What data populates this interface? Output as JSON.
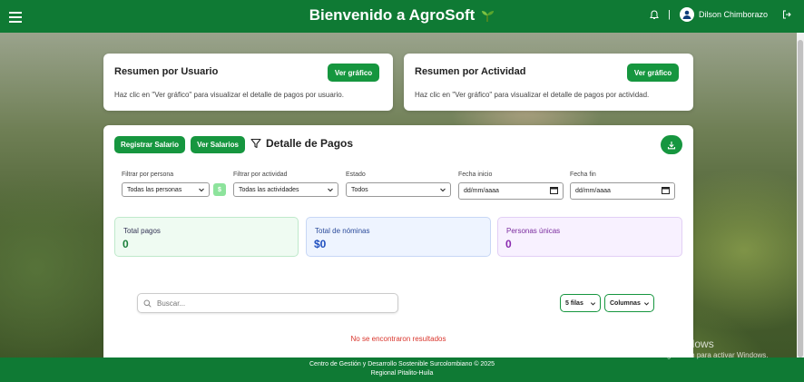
{
  "header": {
    "title": "Bienvenido a AgroSoft",
    "user_name": "Dilson Chimborazo",
    "separator": "|",
    "brand_color": "#0f7a34"
  },
  "summary_cards": [
    {
      "title": "Resumen por Usuario",
      "button": "Ver gráfico",
      "description": "Haz clic en \"Ver gráfico\" para visualizar el detalle de pagos por usuario."
    },
    {
      "title": "Resumen por Actividad",
      "button": "Ver gráfico",
      "description": "Haz clic en \"Ver gráfico\" para visualizar el detalle de pagos por actividad."
    }
  ],
  "main": {
    "register_salary": "Registrar Salario",
    "view_salaries": "Ver Salarios",
    "title": "Detalle de Pagos"
  },
  "filters": {
    "person": {
      "label": "Filtrar por persona",
      "value": "Todas las personas",
      "button": "$"
    },
    "activity": {
      "label": "Filtrar por actividad",
      "value": "Todas las actividades"
    },
    "status": {
      "label": "Estado",
      "value": "Todos"
    },
    "date_start": {
      "label": "Fecha inicio",
      "value": "dd/mm/aaaa"
    },
    "date_end": {
      "label": "Fecha fin",
      "value": "dd/mm/aaaa"
    }
  },
  "stats": [
    {
      "label": "Total pagos",
      "value": "0"
    },
    {
      "label": "Total de nóminas",
      "value": "$0"
    },
    {
      "label": "Personas únicas",
      "value": "0"
    }
  ],
  "table": {
    "search_placeholder": "Buscar...",
    "rows_select": "5 filas",
    "columns_button": "Columnas",
    "empty_message": "No se encontraron resultados"
  },
  "footer": {
    "line1": "Centro de Gestión y Desarrollo Sostenible Surcolombiano © 2025",
    "line2": "Regional Pitalito-Huila"
  },
  "watermark": {
    "line1": "Activar Windows",
    "line2": "Ve a Configuración para activar Windows."
  }
}
